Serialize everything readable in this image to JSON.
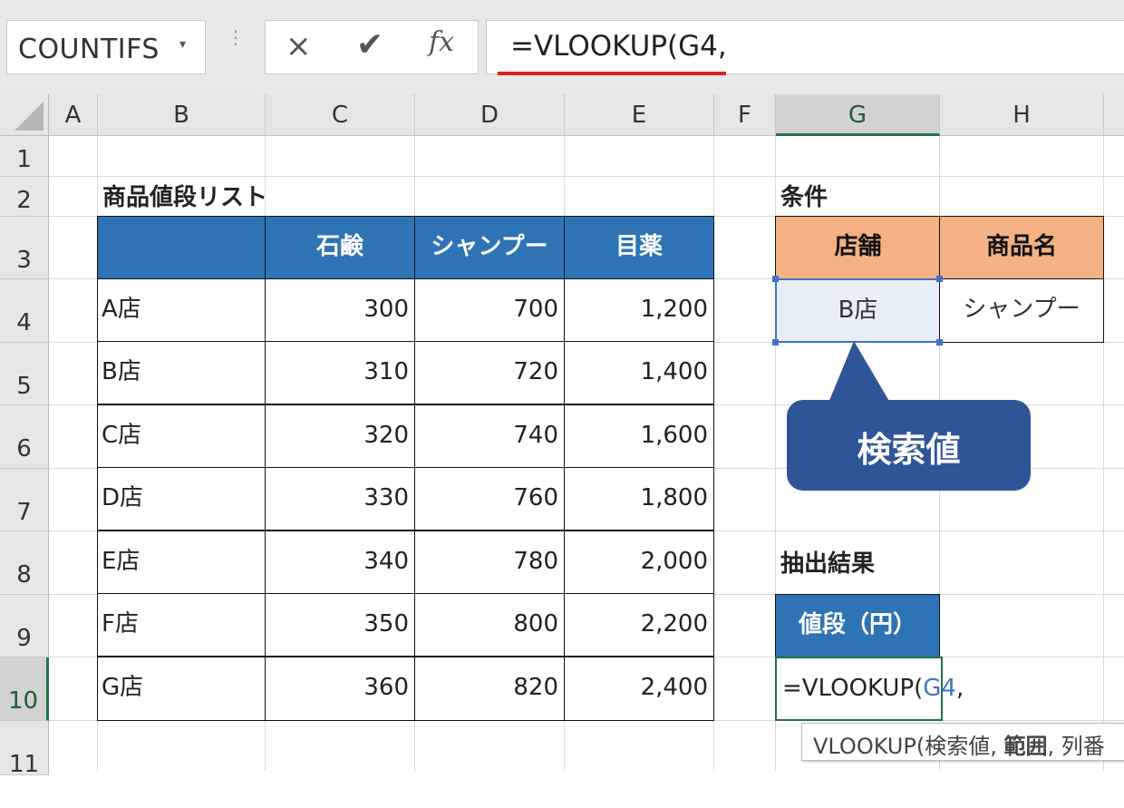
{
  "name_box": {
    "value": "COUNTIFS"
  },
  "formula_bar": {
    "cancel_icon": "×",
    "enter_icon": "✔",
    "fx_label": "fx",
    "formula": "=VLOOKUP(G4,"
  },
  "columns": [
    "A",
    "B",
    "C",
    "D",
    "E",
    "F",
    "G",
    "H"
  ],
  "rows": [
    "1",
    "2",
    "3",
    "4",
    "5",
    "6",
    "7",
    "8",
    "9",
    "10",
    "11"
  ],
  "selected_column": "G",
  "selected_row": "10",
  "price_list": {
    "title": "商品値段リスト",
    "headers": [
      "",
      "石鹸",
      "シャンプー",
      "目薬"
    ],
    "rows": [
      {
        "store": "A店",
        "values": [
          "300",
          "700",
          "1,200"
        ]
      },
      {
        "store": "B店",
        "values": [
          "310",
          "720",
          "1,400"
        ]
      },
      {
        "store": "C店",
        "values": [
          "320",
          "740",
          "1,600"
        ]
      },
      {
        "store": "D店",
        "values": [
          "330",
          "760",
          "1,800"
        ]
      },
      {
        "store": "E店",
        "values": [
          "340",
          "780",
          "2,000"
        ]
      },
      {
        "store": "F店",
        "values": [
          "350",
          "800",
          "2,200"
        ]
      },
      {
        "store": "G店",
        "values": [
          "360",
          "820",
          "2,400"
        ]
      }
    ]
  },
  "conditions": {
    "title": "条件",
    "store_header": "店舗",
    "product_header": "商品名",
    "store_value": "B店",
    "product_value": "シャンプー"
  },
  "callout": {
    "text": "検索値"
  },
  "result": {
    "title": "抽出結果",
    "header": "値段（円）",
    "edit_prefix": "=VLOOKUP(",
    "edit_ref": "G4",
    "edit_suffix": ","
  },
  "tooltip": {
    "prefix": "VLOOKUP(検索値, ",
    "bold_arg": "範囲",
    "suffix": ", 列番"
  },
  "colors": {
    "table_header": "#2e74b5",
    "condition_header": "#f4b183",
    "callout": "#2f5597",
    "reference": "#4472c4",
    "selection": "#217346"
  }
}
